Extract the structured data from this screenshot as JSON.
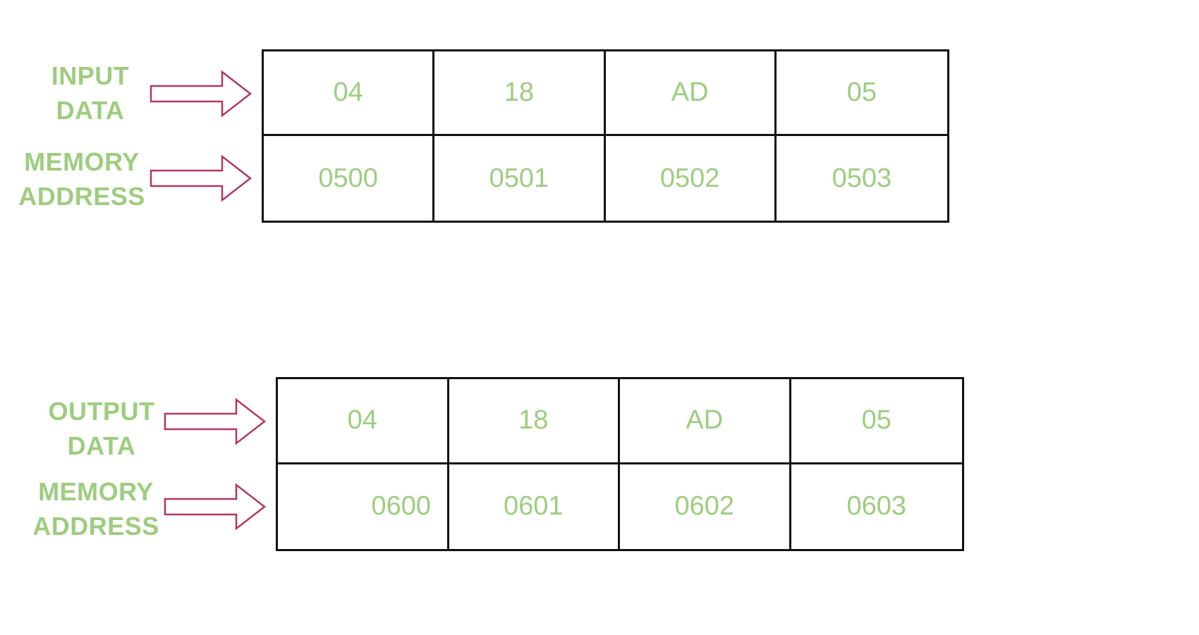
{
  "input": {
    "data_label": [
      "INPUT",
      "DATA"
    ],
    "address_label": [
      "MEMORY",
      "ADDRESS"
    ],
    "data": [
      "04",
      "18",
      "AD",
      "05"
    ],
    "addresses": [
      "0500",
      "0501",
      "0502",
      "0503"
    ]
  },
  "output": {
    "data_label": [
      "OUTPUT",
      "DATA"
    ],
    "address_label": [
      "MEMORY",
      "ADDRESS"
    ],
    "data": [
      "04",
      "18",
      "AD",
      "05"
    ],
    "addresses": [
      "0600",
      "0601",
      "0602",
      "0603"
    ]
  },
  "colors": {
    "text": "#9dcd7e",
    "arrow": "#b5375a",
    "border": "#111111"
  }
}
